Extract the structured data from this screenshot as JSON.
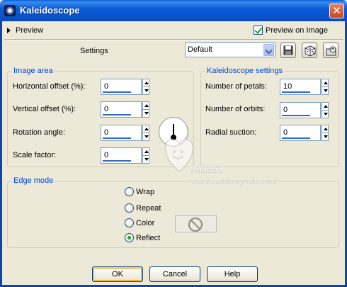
{
  "window": {
    "title": "Kaleidoscope",
    "close_glyph": "✕"
  },
  "top": {
    "preview_label": "Preview",
    "preview_on_image_label": "Preview on Image",
    "preview_on_image_checked": true
  },
  "settings": {
    "label": "Settings",
    "preset_value": "Default"
  },
  "image_area": {
    "legend": "Image area",
    "rows": [
      {
        "label": "Horizontal offset (%):",
        "value": "0"
      },
      {
        "label": "Vertical offset (%):",
        "value": "0"
      },
      {
        "label": "Rotation angle:",
        "value": "0"
      },
      {
        "label": "Scale factor:",
        "value": "0"
      }
    ]
  },
  "kaleidoscope_settings": {
    "legend": "Kaleidoscope settings",
    "rows": [
      {
        "label": "Number of petals:",
        "value": "10"
      },
      {
        "label": "Number of orbits:",
        "value": "0"
      },
      {
        "label": "Radial suction:",
        "value": "0"
      }
    ]
  },
  "edge_mode": {
    "legend": "Edge mode",
    "options": [
      "Wrap",
      "Repeat",
      "Color",
      "Reflect"
    ],
    "selected": "Reflect"
  },
  "watermark": {
    "line1": "Pinuccia",
    "line2": "www.maidiragrafica.eu"
  },
  "buttons": {
    "ok": "OK",
    "cancel": "Cancel",
    "help": "Help"
  },
  "colors": {
    "title_bar": "#0b5bd6",
    "legend_text": "#0046d5",
    "dialog_bg": "#ece9d8",
    "check_green": "#21a121"
  }
}
